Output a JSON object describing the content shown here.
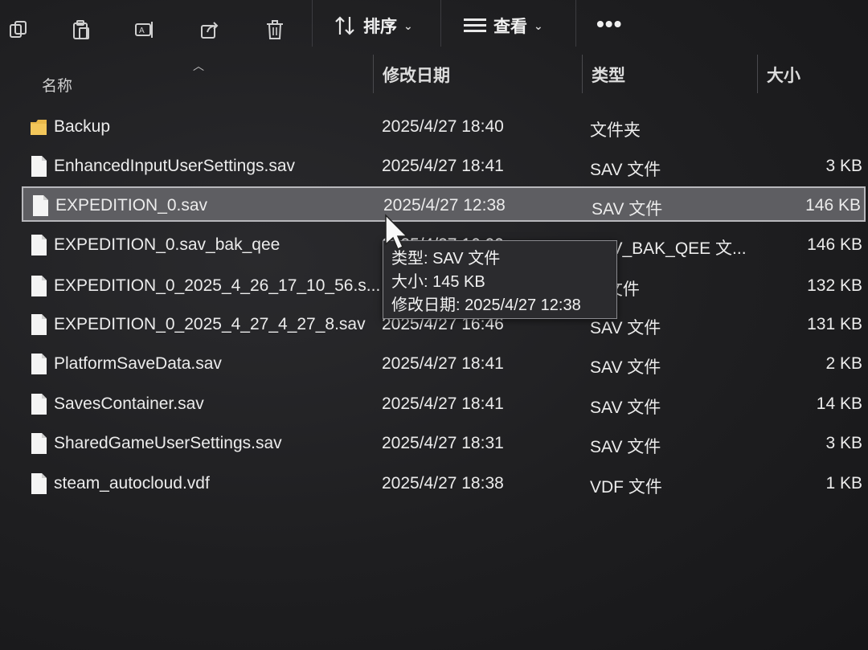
{
  "toolbar": {
    "icons": [
      "copy-icon",
      "paste-icon",
      "rename-icon",
      "share-icon",
      "delete-icon"
    ],
    "sort_label": "排序",
    "view_label": "查看",
    "more_label": "•••"
  },
  "columns": {
    "name": "名称",
    "modified": "修改日期",
    "type": "类型",
    "size": "大小"
  },
  "files": [
    {
      "name": "Backup",
      "modified": "2025/4/27 18:40",
      "type": "文件夹",
      "size": "",
      "kind": "folder"
    },
    {
      "name": "EnhancedInputUserSettings.sav",
      "modified": "2025/4/27 18:41",
      "type": "SAV 文件",
      "size": "3 KB",
      "kind": "file"
    },
    {
      "name": "EXPEDITION_0.sav",
      "modified": "2025/4/27 12:38",
      "type": "SAV 文件",
      "size": "146 KB",
      "kind": "file",
      "selected": true
    },
    {
      "name": "EXPEDITION_0.sav_bak_qee",
      "modified": "2025/4/27 16:00",
      "type": "SAV_BAK_QEE 文...",
      "size": "146 KB",
      "kind": "file"
    },
    {
      "name": "EXPEDITION_0_2025_4_26_17_10_56.s...",
      "modified": "",
      "type": "V 文件",
      "size": "132 KB",
      "kind": "file"
    },
    {
      "name": "EXPEDITION_0_2025_4_27_4_27_8.sav",
      "modified": "2025/4/27 16:46",
      "type": "SAV 文件",
      "size": "131 KB",
      "kind": "file"
    },
    {
      "name": "PlatformSaveData.sav",
      "modified": "2025/4/27 18:41",
      "type": "SAV 文件",
      "size": "2 KB",
      "kind": "file"
    },
    {
      "name": "SavesContainer.sav",
      "modified": "2025/4/27 18:41",
      "type": "SAV 文件",
      "size": "14 KB",
      "kind": "file"
    },
    {
      "name": "SharedGameUserSettings.sav",
      "modified": "2025/4/27 18:31",
      "type": "SAV 文件",
      "size": "3 KB",
      "kind": "file"
    },
    {
      "name": "steam_autocloud.vdf",
      "modified": "2025/4/27 18:38",
      "type": "VDF 文件",
      "size": "1 KB",
      "kind": "file"
    }
  ],
  "tooltip": {
    "type_line": "类型: SAV 文件",
    "size_line": "大小: 145 KB",
    "modified_line": "修改日期: 2025/4/27 12:38"
  },
  "colors": {
    "folder": "#e8b84a",
    "selection": "#5e5e62",
    "background": "#1e1e20"
  }
}
